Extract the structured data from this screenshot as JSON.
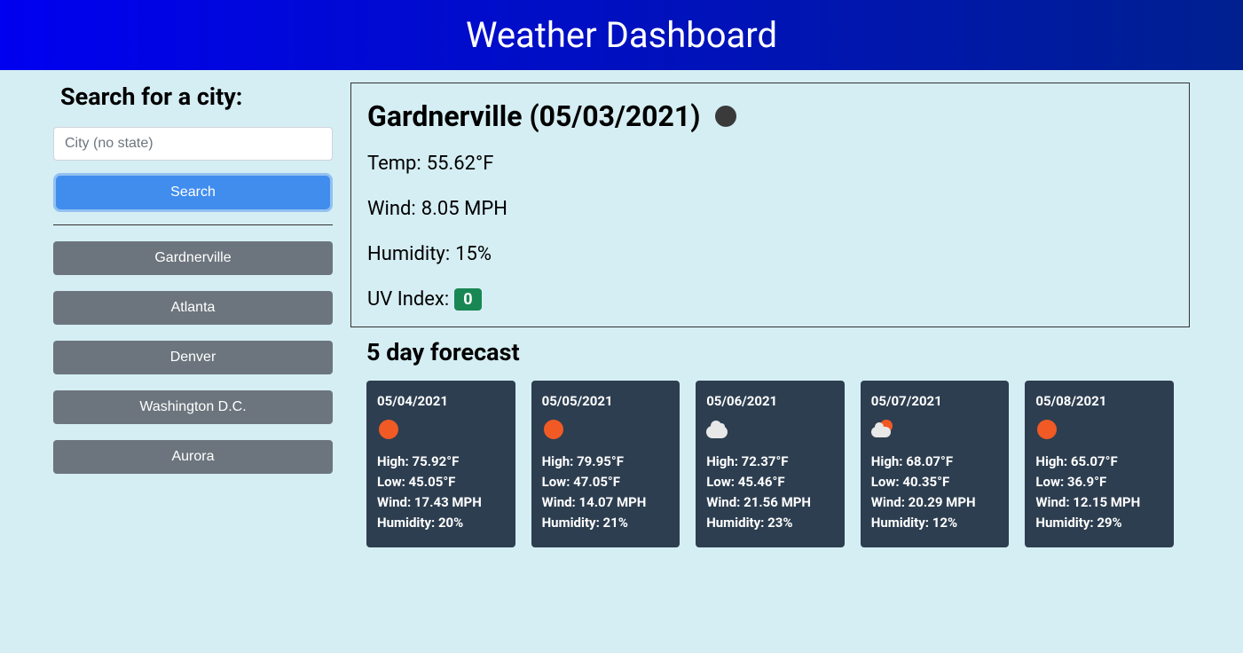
{
  "header": {
    "title": "Weather Dashboard"
  },
  "sidebar": {
    "search_heading": "Search for a city:",
    "search_placeholder": "City (no state)",
    "search_button": "Search",
    "history": [
      "Gardnerville",
      "Atlanta",
      "Denver",
      "Washington D.C.",
      "Aurora"
    ]
  },
  "current": {
    "city": "Gardnerville",
    "date": "05/03/2021",
    "title": "Gardnerville (05/03/2021)",
    "icon": "dark-sun",
    "temp_label": "Temp:",
    "temp_value": "55.62°F",
    "wind_label": "Wind:",
    "wind_value": "8.05 MPH",
    "humidity_label": "Humidity:",
    "humidity_value": "15%",
    "uv_label": "UV Index:",
    "uv_value": "0",
    "uv_color": "#198754"
  },
  "forecast": {
    "heading": "5 day forecast",
    "days": [
      {
        "date": "05/04/2021",
        "icon": "sun",
        "high": "High: 75.92°F",
        "low": "Low: 45.05°F",
        "wind": "Wind: 17.43 MPH",
        "humidity": "Humidity: 20%"
      },
      {
        "date": "05/05/2021",
        "icon": "sun",
        "high": "High: 79.95°F",
        "low": "Low: 47.05°F",
        "wind": "Wind: 14.07 MPH",
        "humidity": "Humidity: 21%"
      },
      {
        "date": "05/06/2021",
        "icon": "cloud",
        "high": "High: 72.37°F",
        "low": "Low: 45.46°F",
        "wind": "Wind: 21.56 MPH",
        "humidity": "Humidity: 23%"
      },
      {
        "date": "05/07/2021",
        "icon": "cloud-sun",
        "high": "High: 68.07°F",
        "low": "Low: 40.35°F",
        "wind": "Wind: 20.29 MPH",
        "humidity": "Humidity: 12%"
      },
      {
        "date": "05/08/2021",
        "icon": "sun",
        "high": "High: 65.07°F",
        "low": "Low: 36.9°F",
        "wind": "Wind: 12.15 MPH",
        "humidity": "Humidity: 29%"
      }
    ]
  }
}
